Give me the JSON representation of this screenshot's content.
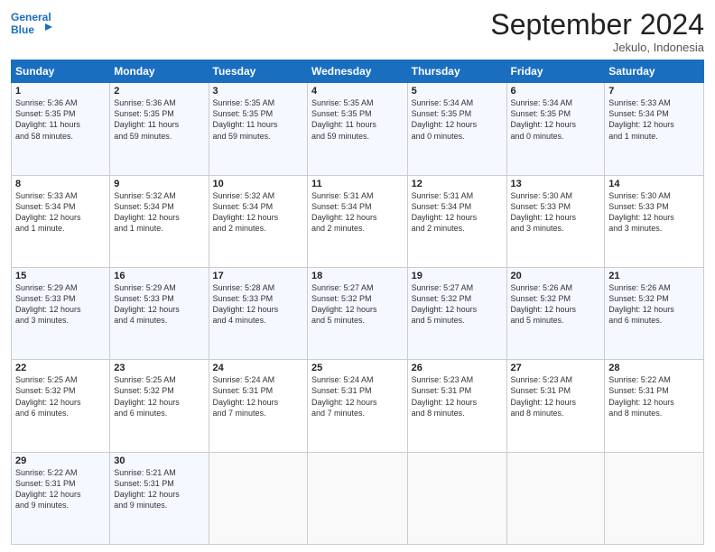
{
  "logo": {
    "line1": "General",
    "line2": "Blue"
  },
  "title": "September 2024",
  "location": "Jekulo, Indonesia",
  "weekdays": [
    "Sunday",
    "Monday",
    "Tuesday",
    "Wednesday",
    "Thursday",
    "Friday",
    "Saturday"
  ],
  "weeks": [
    [
      {
        "day": "1",
        "info": "Sunrise: 5:36 AM\nSunset: 5:35 PM\nDaylight: 11 hours\nand 58 minutes."
      },
      {
        "day": "2",
        "info": "Sunrise: 5:36 AM\nSunset: 5:35 PM\nDaylight: 11 hours\nand 59 minutes."
      },
      {
        "day": "3",
        "info": "Sunrise: 5:35 AM\nSunset: 5:35 PM\nDaylight: 11 hours\nand 59 minutes."
      },
      {
        "day": "4",
        "info": "Sunrise: 5:35 AM\nSunset: 5:35 PM\nDaylight: 11 hours\nand 59 minutes."
      },
      {
        "day": "5",
        "info": "Sunrise: 5:34 AM\nSunset: 5:35 PM\nDaylight: 12 hours\nand 0 minutes."
      },
      {
        "day": "6",
        "info": "Sunrise: 5:34 AM\nSunset: 5:35 PM\nDaylight: 12 hours\nand 0 minutes."
      },
      {
        "day": "7",
        "info": "Sunrise: 5:33 AM\nSunset: 5:34 PM\nDaylight: 12 hours\nand 1 minute."
      }
    ],
    [
      {
        "day": "8",
        "info": "Sunrise: 5:33 AM\nSunset: 5:34 PM\nDaylight: 12 hours\nand 1 minute."
      },
      {
        "day": "9",
        "info": "Sunrise: 5:32 AM\nSunset: 5:34 PM\nDaylight: 12 hours\nand 1 minute."
      },
      {
        "day": "10",
        "info": "Sunrise: 5:32 AM\nSunset: 5:34 PM\nDaylight: 12 hours\nand 2 minutes."
      },
      {
        "day": "11",
        "info": "Sunrise: 5:31 AM\nSunset: 5:34 PM\nDaylight: 12 hours\nand 2 minutes."
      },
      {
        "day": "12",
        "info": "Sunrise: 5:31 AM\nSunset: 5:34 PM\nDaylight: 12 hours\nand 2 minutes."
      },
      {
        "day": "13",
        "info": "Sunrise: 5:30 AM\nSunset: 5:33 PM\nDaylight: 12 hours\nand 3 minutes."
      },
      {
        "day": "14",
        "info": "Sunrise: 5:30 AM\nSunset: 5:33 PM\nDaylight: 12 hours\nand 3 minutes."
      }
    ],
    [
      {
        "day": "15",
        "info": "Sunrise: 5:29 AM\nSunset: 5:33 PM\nDaylight: 12 hours\nand 3 minutes."
      },
      {
        "day": "16",
        "info": "Sunrise: 5:29 AM\nSunset: 5:33 PM\nDaylight: 12 hours\nand 4 minutes."
      },
      {
        "day": "17",
        "info": "Sunrise: 5:28 AM\nSunset: 5:33 PM\nDaylight: 12 hours\nand 4 minutes."
      },
      {
        "day": "18",
        "info": "Sunrise: 5:27 AM\nSunset: 5:32 PM\nDaylight: 12 hours\nand 5 minutes."
      },
      {
        "day": "19",
        "info": "Sunrise: 5:27 AM\nSunset: 5:32 PM\nDaylight: 12 hours\nand 5 minutes."
      },
      {
        "day": "20",
        "info": "Sunrise: 5:26 AM\nSunset: 5:32 PM\nDaylight: 12 hours\nand 5 minutes."
      },
      {
        "day": "21",
        "info": "Sunrise: 5:26 AM\nSunset: 5:32 PM\nDaylight: 12 hours\nand 6 minutes."
      }
    ],
    [
      {
        "day": "22",
        "info": "Sunrise: 5:25 AM\nSunset: 5:32 PM\nDaylight: 12 hours\nand 6 minutes."
      },
      {
        "day": "23",
        "info": "Sunrise: 5:25 AM\nSunset: 5:32 PM\nDaylight: 12 hours\nand 6 minutes."
      },
      {
        "day": "24",
        "info": "Sunrise: 5:24 AM\nSunset: 5:31 PM\nDaylight: 12 hours\nand 7 minutes."
      },
      {
        "day": "25",
        "info": "Sunrise: 5:24 AM\nSunset: 5:31 PM\nDaylight: 12 hours\nand 7 minutes."
      },
      {
        "day": "26",
        "info": "Sunrise: 5:23 AM\nSunset: 5:31 PM\nDaylight: 12 hours\nand 8 minutes."
      },
      {
        "day": "27",
        "info": "Sunrise: 5:23 AM\nSunset: 5:31 PM\nDaylight: 12 hours\nand 8 minutes."
      },
      {
        "day": "28",
        "info": "Sunrise: 5:22 AM\nSunset: 5:31 PM\nDaylight: 12 hours\nand 8 minutes."
      }
    ],
    [
      {
        "day": "29",
        "info": "Sunrise: 5:22 AM\nSunset: 5:31 PM\nDaylight: 12 hours\nand 9 minutes."
      },
      {
        "day": "30",
        "info": "Sunrise: 5:21 AM\nSunset: 5:31 PM\nDaylight: 12 hours\nand 9 minutes."
      },
      {
        "day": "",
        "info": ""
      },
      {
        "day": "",
        "info": ""
      },
      {
        "day": "",
        "info": ""
      },
      {
        "day": "",
        "info": ""
      },
      {
        "day": "",
        "info": ""
      }
    ]
  ]
}
